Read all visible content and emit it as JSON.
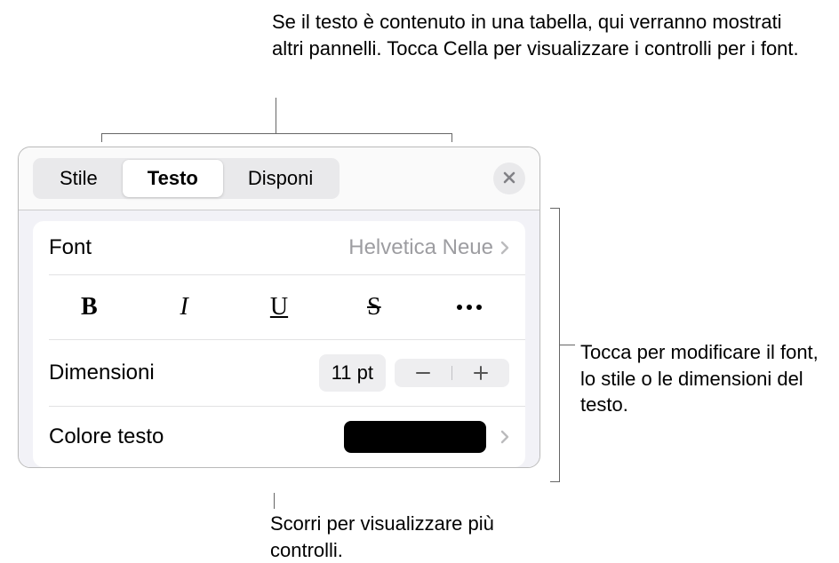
{
  "annotations": {
    "top": "Se il testo è contenuto in una tabella, qui verranno mostrati altri pannelli. Tocca Cella per visualizzare i controlli per i font.",
    "right": "Tocca per modificare il font, lo stile o le dimensioni del testo.",
    "bottom": "Scorri per visualizzare più controlli."
  },
  "header": {
    "tabs": [
      "Stile",
      "Testo",
      "Disponi"
    ],
    "active_tab_index": 1
  },
  "rows": {
    "font": {
      "label": "Font",
      "value": "Helvetica Neue"
    },
    "styles": {
      "bold": "B",
      "italic": "I",
      "underline": "U",
      "strike": "S"
    },
    "size": {
      "label": "Dimensioni",
      "value": "11 pt"
    },
    "text_color": {
      "label": "Colore testo",
      "color": "#000000"
    }
  }
}
